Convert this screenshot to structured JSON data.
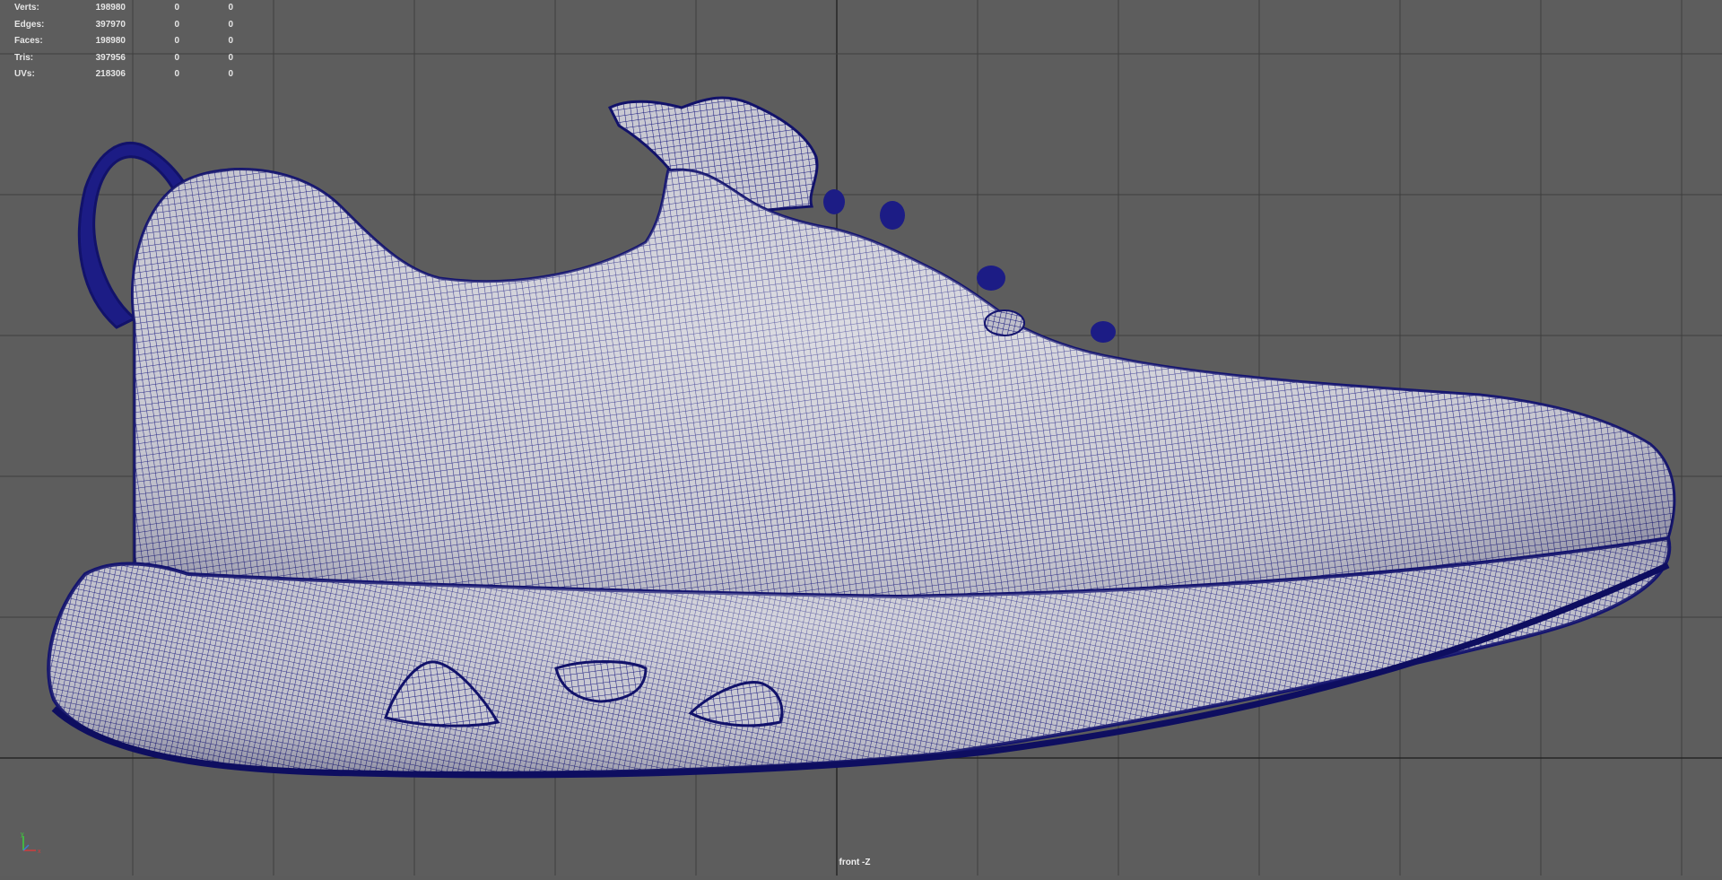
{
  "viewport": {
    "camera_label": "front -Z",
    "background_color": "#5d5d5d",
    "grid_color": "#3e3e3e",
    "axis_color": "#262626",
    "wireframe_color": "#14147a",
    "surface_color": "#c6c6ce"
  },
  "hud": {
    "rows": [
      {
        "label": "Verts:",
        "v1": "198980",
        "v2": "0",
        "v3": "0"
      },
      {
        "label": "Edges:",
        "v1": "397970",
        "v2": "0",
        "v3": "0"
      },
      {
        "label": "Faces:",
        "v1": "198980",
        "v2": "0",
        "v3": "0"
      },
      {
        "label": "Tris:",
        "v1": "397956",
        "v2": "0",
        "v3": "0"
      },
      {
        "label": "UVs:",
        "v1": "218306",
        "v2": "0",
        "v3": "0"
      }
    ]
  },
  "gizmo": {
    "x_color": "#d23c3c",
    "y_color": "#3cd23c",
    "z_color": "#3c7cd2",
    "icon": "axis-gizmo-icon"
  },
  "model": {
    "name": "shoe-mesh",
    "icon": "shoe-wireframe"
  }
}
